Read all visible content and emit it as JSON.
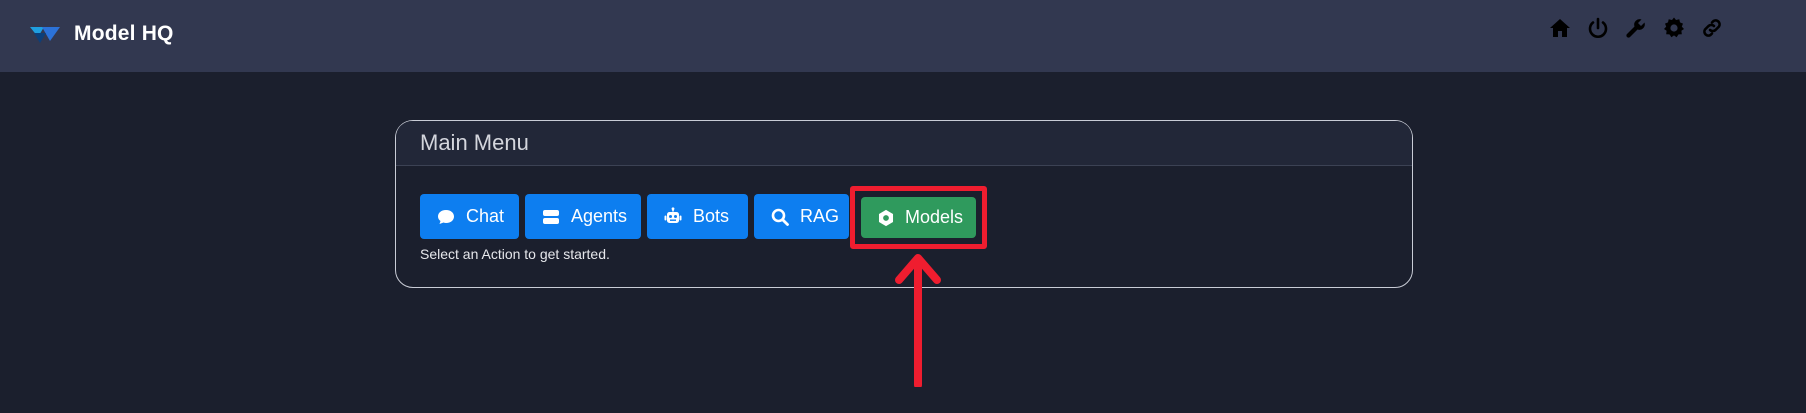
{
  "app": {
    "brand_name": "Model HQ",
    "logo_icon": "model-hq-logo"
  },
  "nav": {
    "icons": [
      "home-icon",
      "power-icon",
      "wrench-icon",
      "gear-icon",
      "link-icon"
    ]
  },
  "main_menu": {
    "title": "Main Menu",
    "buttons": [
      {
        "label": "Chat",
        "icon": "chat-icon",
        "color": "#0d7ef0"
      },
      {
        "label": "Agents",
        "icon": "server-icon",
        "color": "#0d7ef0"
      },
      {
        "label": "Bots",
        "icon": "robot-icon",
        "color": "#0d7ef0"
      },
      {
        "label": "RAG",
        "icon": "search-icon",
        "color": "#0d7ef0"
      },
      {
        "label": "Models",
        "icon": "gear-icon",
        "color": "#2f9a5d",
        "highlighted": true
      }
    ],
    "helper_text": "Select an Action to get started."
  },
  "colors": {
    "topbar": "#323850",
    "background": "#1b1f2d",
    "primary_button": "#0d7ef0",
    "models_button": "#2f9a5d",
    "annotation": "#ef1d2f"
  }
}
